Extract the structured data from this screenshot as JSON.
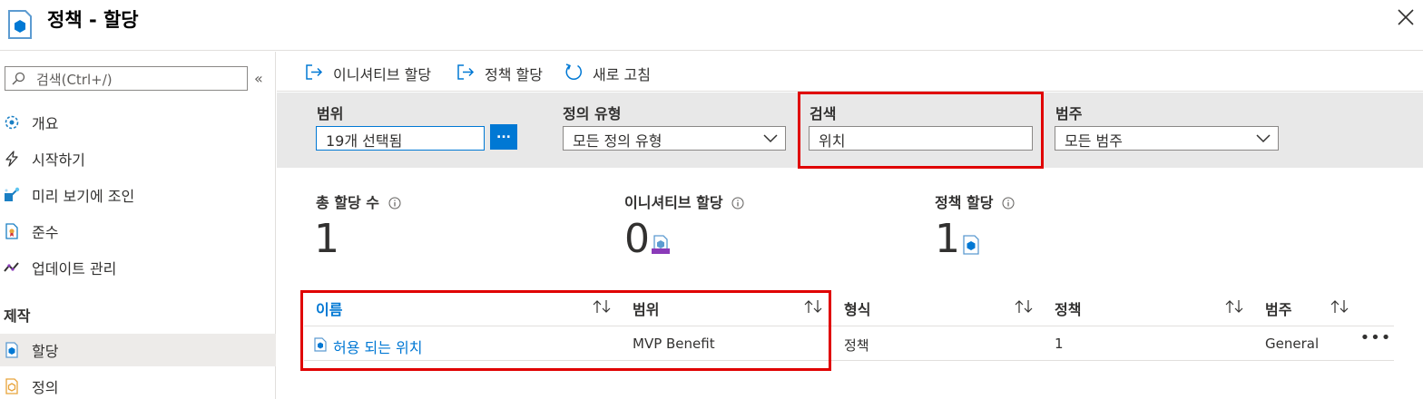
{
  "header": {
    "title": "정책 - 할당"
  },
  "sidebar": {
    "search_placeholder": "검색(Ctrl+/)",
    "collapse": "«",
    "items": [
      {
        "label": "개요",
        "icon": "overview-icon"
      },
      {
        "label": "시작하기",
        "icon": "lightning-icon"
      },
      {
        "label": "미리 보기에 조인",
        "icon": "preview-icon"
      },
      {
        "label": "준수",
        "icon": "compliance-icon"
      },
      {
        "label": "업데이트 관리",
        "icon": "update-icon"
      }
    ],
    "section_title": "제작",
    "section_items": [
      {
        "label": "할당",
        "icon": "assignment-icon",
        "selected": true
      },
      {
        "label": "정의",
        "icon": "definition-icon"
      }
    ]
  },
  "toolbar": {
    "assign_initiative": "이니셔티브 할당",
    "assign_policy": "정책 할당",
    "refresh": "새로 고침"
  },
  "filters": {
    "scope_label": "범위",
    "scope_value": "19개 선택됨",
    "scope_button": "...",
    "definition_type_label": "정의 유형",
    "definition_type_value": "모든 정의 유형",
    "search_label": "검색",
    "search_value": "위치",
    "category_label": "범주",
    "category_value": "모든 범주"
  },
  "stats": {
    "total_label": "총 할당 수",
    "total_value": "1",
    "initiative_label": "이니셔티브 할당",
    "initiative_value": "0",
    "policy_label": "정책 할당",
    "policy_value": "1"
  },
  "table": {
    "columns": [
      "이름",
      "범위",
      "형식",
      "정책",
      "범주"
    ],
    "rows": [
      {
        "name": "허용 되는 위치",
        "scope": "MVP Benefit",
        "type": "정책",
        "policies": "1",
        "category": "General",
        "more": "•••"
      }
    ]
  },
  "colors": {
    "accent": "#0078d4",
    "highlight": "#e00000",
    "filter_bg": "#e8e8e8"
  }
}
